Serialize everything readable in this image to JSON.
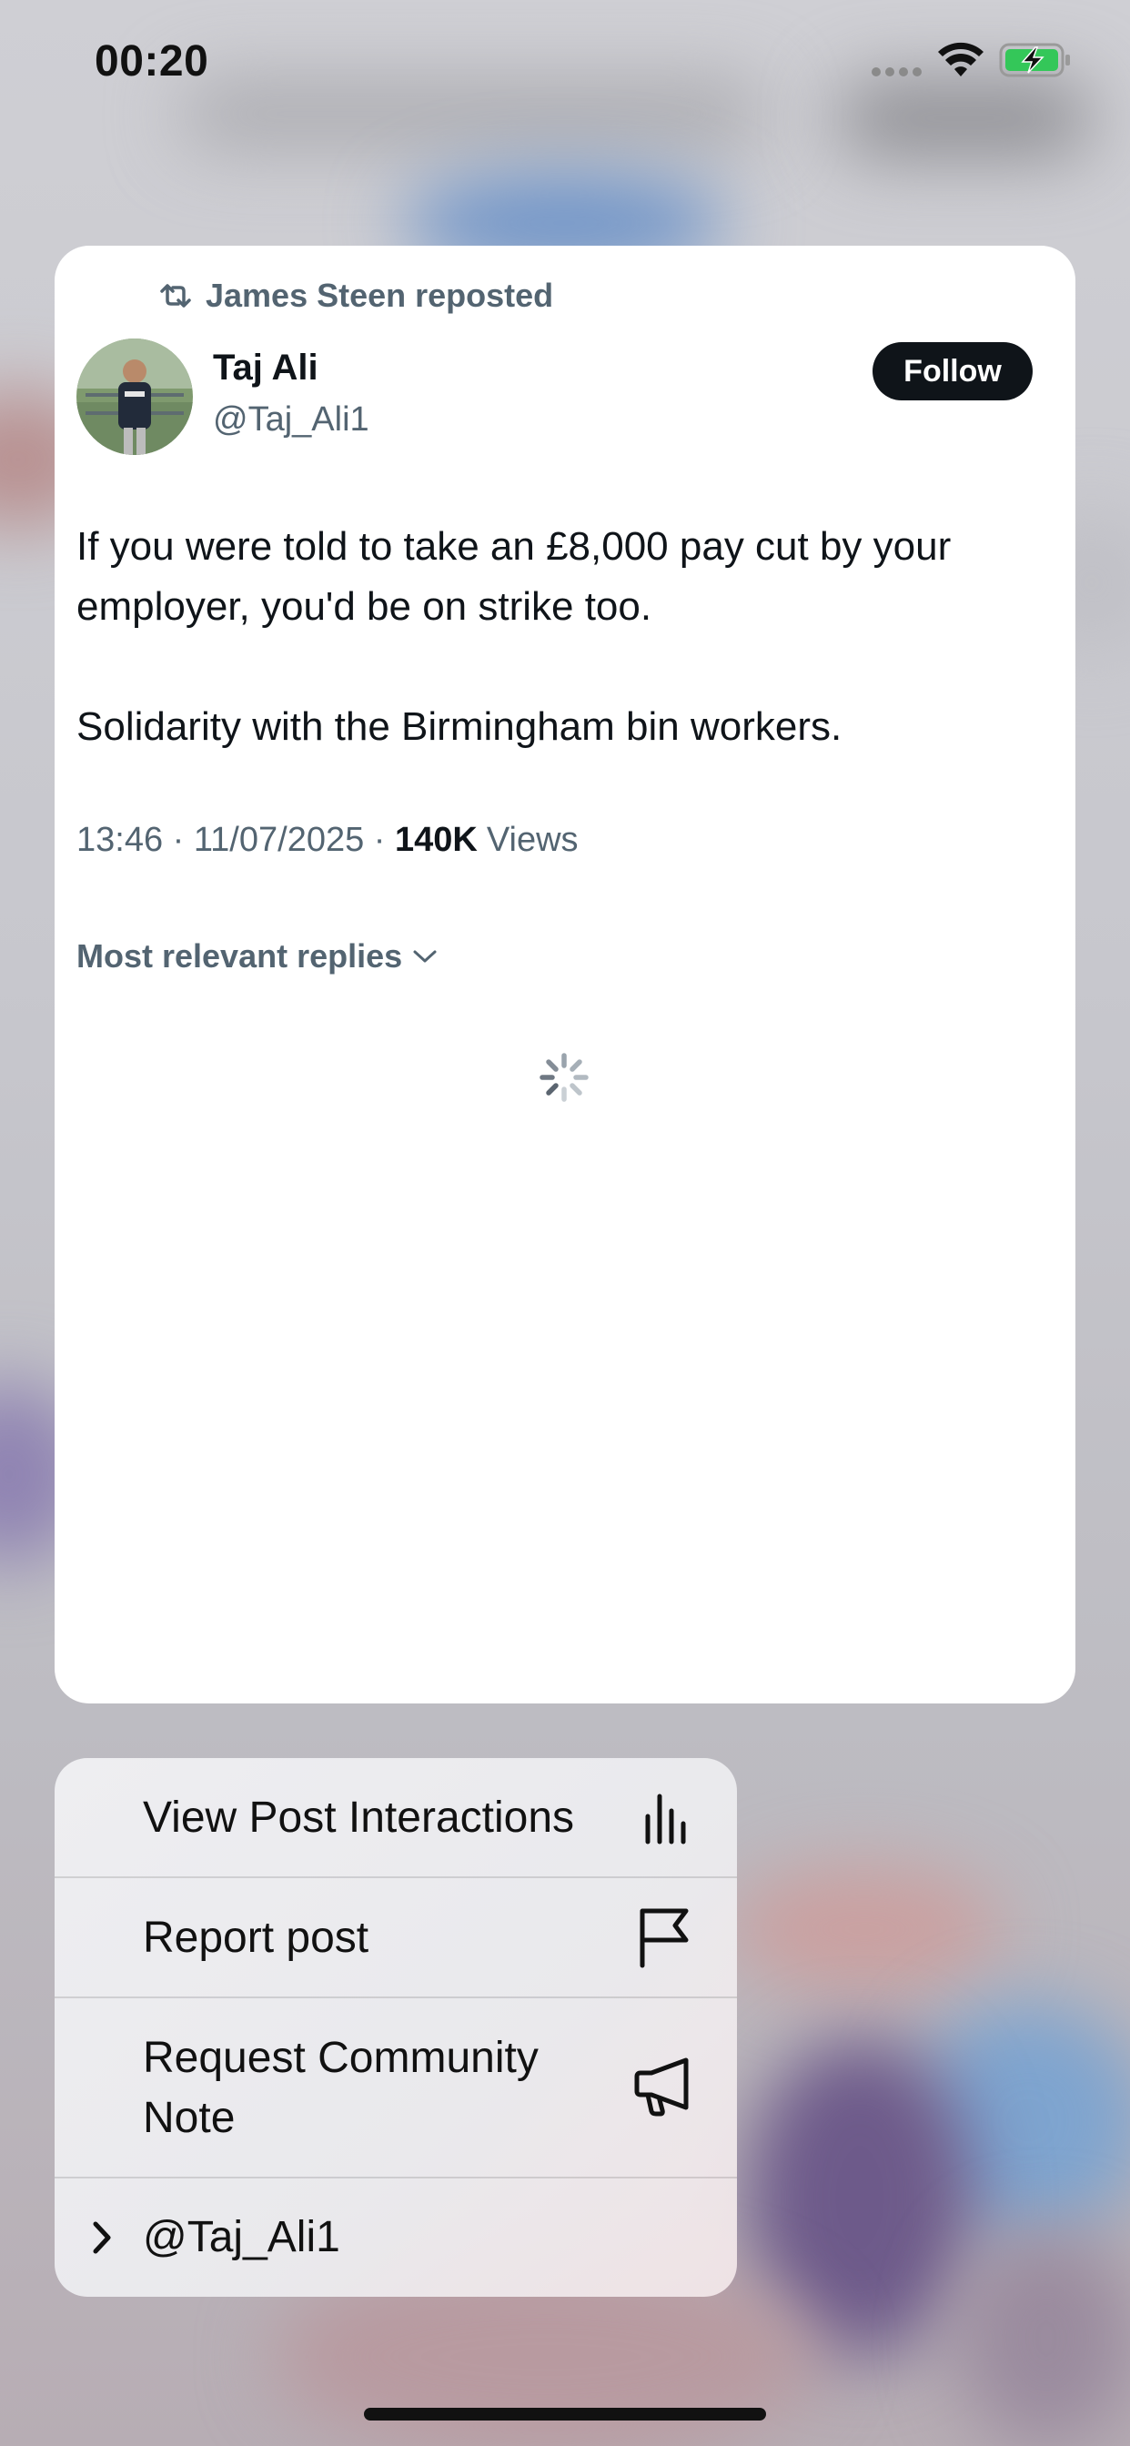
{
  "status_bar": {
    "time": "00:20",
    "icons": [
      "cellular-signal-icon",
      "wifi-icon",
      "battery-charging-icon"
    ]
  },
  "post": {
    "repost_label": "James Steen reposted",
    "author_name": "Taj Ali",
    "author_handle": "@Taj_Ali1",
    "follow_label": "Follow",
    "text_paragraph_1": "If you were told to take an £8,000 pay cut by your employer, you'd be on strike too.",
    "text_paragraph_2": "Solidarity with the Birmingham bin workers.",
    "timestamp": "13:46 · 11/07/2025 · ",
    "views_count": "140K",
    "views_label": "Views",
    "replies_sort_label": "Most relevant replies"
  },
  "context_menu": {
    "items": [
      {
        "label": "View Post Interactions",
        "icon": "bar-chart-icon"
      },
      {
        "label": "Report post",
        "icon": "flag-icon"
      },
      {
        "label": "Request Community Note",
        "icon": "megaphone-icon"
      },
      {
        "label": "@Taj_Ali1",
        "icon": "chevron-right-icon"
      }
    ]
  },
  "colors": {
    "primary_text": "#0f1419",
    "secondary_text": "#536471",
    "follow_button": "#0f1419",
    "battery_green": "#34c759"
  }
}
